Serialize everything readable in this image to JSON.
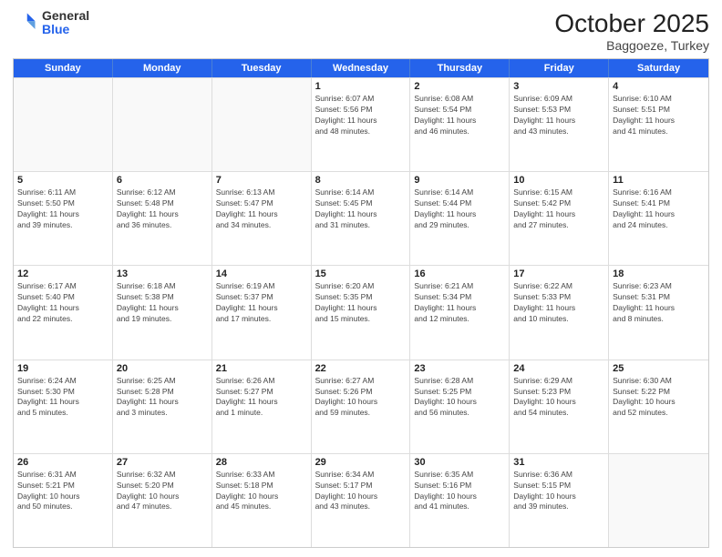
{
  "logo": {
    "general": "General",
    "blue": "Blue"
  },
  "header": {
    "month": "October 2025",
    "location": "Baggoeze, Turkey"
  },
  "weekdays": [
    "Sunday",
    "Monday",
    "Tuesday",
    "Wednesday",
    "Thursday",
    "Friday",
    "Saturday"
  ],
  "rows": [
    [
      {
        "day": "",
        "info": ""
      },
      {
        "day": "",
        "info": ""
      },
      {
        "day": "",
        "info": ""
      },
      {
        "day": "1",
        "info": "Sunrise: 6:07 AM\nSunset: 5:56 PM\nDaylight: 11 hours\nand 48 minutes."
      },
      {
        "day": "2",
        "info": "Sunrise: 6:08 AM\nSunset: 5:54 PM\nDaylight: 11 hours\nand 46 minutes."
      },
      {
        "day": "3",
        "info": "Sunrise: 6:09 AM\nSunset: 5:53 PM\nDaylight: 11 hours\nand 43 minutes."
      },
      {
        "day": "4",
        "info": "Sunrise: 6:10 AM\nSunset: 5:51 PM\nDaylight: 11 hours\nand 41 minutes."
      }
    ],
    [
      {
        "day": "5",
        "info": "Sunrise: 6:11 AM\nSunset: 5:50 PM\nDaylight: 11 hours\nand 39 minutes."
      },
      {
        "day": "6",
        "info": "Sunrise: 6:12 AM\nSunset: 5:48 PM\nDaylight: 11 hours\nand 36 minutes."
      },
      {
        "day": "7",
        "info": "Sunrise: 6:13 AM\nSunset: 5:47 PM\nDaylight: 11 hours\nand 34 minutes."
      },
      {
        "day": "8",
        "info": "Sunrise: 6:14 AM\nSunset: 5:45 PM\nDaylight: 11 hours\nand 31 minutes."
      },
      {
        "day": "9",
        "info": "Sunrise: 6:14 AM\nSunset: 5:44 PM\nDaylight: 11 hours\nand 29 minutes."
      },
      {
        "day": "10",
        "info": "Sunrise: 6:15 AM\nSunset: 5:42 PM\nDaylight: 11 hours\nand 27 minutes."
      },
      {
        "day": "11",
        "info": "Sunrise: 6:16 AM\nSunset: 5:41 PM\nDaylight: 11 hours\nand 24 minutes."
      }
    ],
    [
      {
        "day": "12",
        "info": "Sunrise: 6:17 AM\nSunset: 5:40 PM\nDaylight: 11 hours\nand 22 minutes."
      },
      {
        "day": "13",
        "info": "Sunrise: 6:18 AM\nSunset: 5:38 PM\nDaylight: 11 hours\nand 19 minutes."
      },
      {
        "day": "14",
        "info": "Sunrise: 6:19 AM\nSunset: 5:37 PM\nDaylight: 11 hours\nand 17 minutes."
      },
      {
        "day": "15",
        "info": "Sunrise: 6:20 AM\nSunset: 5:35 PM\nDaylight: 11 hours\nand 15 minutes."
      },
      {
        "day": "16",
        "info": "Sunrise: 6:21 AM\nSunset: 5:34 PM\nDaylight: 11 hours\nand 12 minutes."
      },
      {
        "day": "17",
        "info": "Sunrise: 6:22 AM\nSunset: 5:33 PM\nDaylight: 11 hours\nand 10 minutes."
      },
      {
        "day": "18",
        "info": "Sunrise: 6:23 AM\nSunset: 5:31 PM\nDaylight: 11 hours\nand 8 minutes."
      }
    ],
    [
      {
        "day": "19",
        "info": "Sunrise: 6:24 AM\nSunset: 5:30 PM\nDaylight: 11 hours\nand 5 minutes."
      },
      {
        "day": "20",
        "info": "Sunrise: 6:25 AM\nSunset: 5:28 PM\nDaylight: 11 hours\nand 3 minutes."
      },
      {
        "day": "21",
        "info": "Sunrise: 6:26 AM\nSunset: 5:27 PM\nDaylight: 11 hours\nand 1 minute."
      },
      {
        "day": "22",
        "info": "Sunrise: 6:27 AM\nSunset: 5:26 PM\nDaylight: 10 hours\nand 59 minutes."
      },
      {
        "day": "23",
        "info": "Sunrise: 6:28 AM\nSunset: 5:25 PM\nDaylight: 10 hours\nand 56 minutes."
      },
      {
        "day": "24",
        "info": "Sunrise: 6:29 AM\nSunset: 5:23 PM\nDaylight: 10 hours\nand 54 minutes."
      },
      {
        "day": "25",
        "info": "Sunrise: 6:30 AM\nSunset: 5:22 PM\nDaylight: 10 hours\nand 52 minutes."
      }
    ],
    [
      {
        "day": "26",
        "info": "Sunrise: 6:31 AM\nSunset: 5:21 PM\nDaylight: 10 hours\nand 50 minutes."
      },
      {
        "day": "27",
        "info": "Sunrise: 6:32 AM\nSunset: 5:20 PM\nDaylight: 10 hours\nand 47 minutes."
      },
      {
        "day": "28",
        "info": "Sunrise: 6:33 AM\nSunset: 5:18 PM\nDaylight: 10 hours\nand 45 minutes."
      },
      {
        "day": "29",
        "info": "Sunrise: 6:34 AM\nSunset: 5:17 PM\nDaylight: 10 hours\nand 43 minutes."
      },
      {
        "day": "30",
        "info": "Sunrise: 6:35 AM\nSunset: 5:16 PM\nDaylight: 10 hours\nand 41 minutes."
      },
      {
        "day": "31",
        "info": "Sunrise: 6:36 AM\nSunset: 5:15 PM\nDaylight: 10 hours\nand 39 minutes."
      },
      {
        "day": "",
        "info": ""
      }
    ]
  ]
}
